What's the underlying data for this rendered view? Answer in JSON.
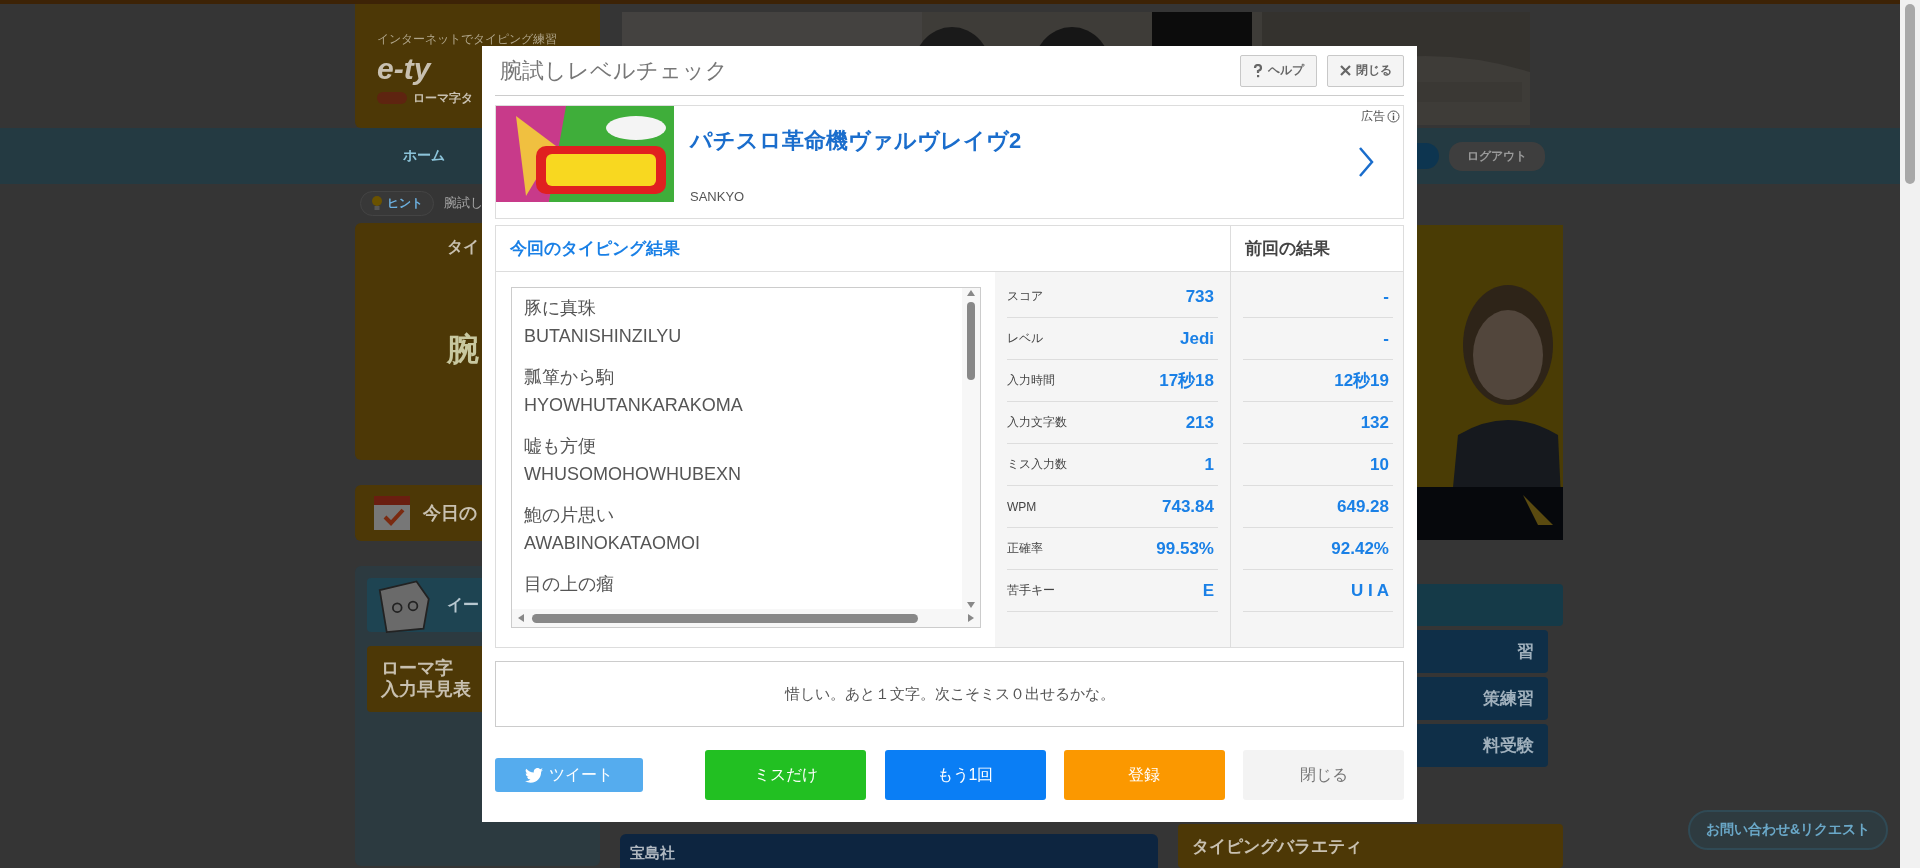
{
  "background": {
    "logo": {
      "tagline": "インターネットでタイピング練習",
      "wordmark": "e-ty",
      "sub": "ローマ字タ"
    },
    "nav": {
      "home": "ホーム",
      "logout": "ログアウト"
    },
    "breadcrumb": {
      "hint": "ヒント",
      "current": "腕試し"
    },
    "left": {
      "panel_title": "タイ",
      "panel_big": "腕",
      "today": "今日の",
      "mascot_title": "イー",
      "romaji_table": [
        "ローマ字",
        "入力早見表"
      ]
    },
    "right_buttons": [
      {
        "kind": "plain"
      },
      {
        "kind": "text",
        "label": "習"
      },
      {
        "kind": "text",
        "label": "策練習"
      },
      {
        "kind": "text",
        "label": "料受験"
      }
    ],
    "bottom": {
      "publisher": "宝島社",
      "variety": "タイピングバラエティ"
    },
    "contact": "お問い合わせ&リクエスト"
  },
  "dialog": {
    "title": "腕試しレベルチェック",
    "help_button": "ヘルプ",
    "close_button": "閉じる",
    "ad": {
      "label": "広告",
      "title": "パチスロ革命機ヴァルヴレイヴ2",
      "advertiser": "SANKYO"
    },
    "current_heading": "今回のタイピング結果",
    "previous_heading": "前回の結果",
    "words": [
      {
        "kanji": "豚に真珠",
        "romaji": "BUTANISHINZILYU"
      },
      {
        "kanji": "瓢箪から駒",
        "romaji": "HYOWHUTANKARAKOMA"
      },
      {
        "kanji": "嘘も方便",
        "romaji": "WHUSOMOHOWHUBEXN"
      },
      {
        "kanji": "鮑の片思い",
        "romaji": "AWABINOKATAOMOI"
      },
      {
        "kanji": "目の上の瘤"
      }
    ],
    "stats": [
      {
        "label": "スコア",
        "current": "733",
        "previous": "-"
      },
      {
        "label": "レベル",
        "current": "Jedi",
        "previous": "-"
      },
      {
        "label": "入力時間",
        "current": "17秒18",
        "previous": "12秒19"
      },
      {
        "label": "入力文字数",
        "current": "213",
        "previous": "132"
      },
      {
        "label": "ミス入力数",
        "current": "1",
        "previous": "10"
      },
      {
        "label": "WPM",
        "current": "743.84",
        "previous": "649.28"
      },
      {
        "label": "正確率",
        "current": "99.53%",
        "previous": "92.42%"
      },
      {
        "label": "苦手キー",
        "current": "E",
        "previous": "U I A"
      }
    ],
    "message": "惜しい。あと１文字。次こそミス０出せるかな。",
    "buttons": [
      {
        "kind": "tweet",
        "label": "ツイート"
      },
      {
        "kind": "miss",
        "label": "ミスだけ"
      },
      {
        "kind": "retry",
        "label": "もう1回"
      },
      {
        "kind": "register",
        "label": "登録"
      },
      {
        "kind": "close",
        "label": "閉じる"
      }
    ]
  }
}
